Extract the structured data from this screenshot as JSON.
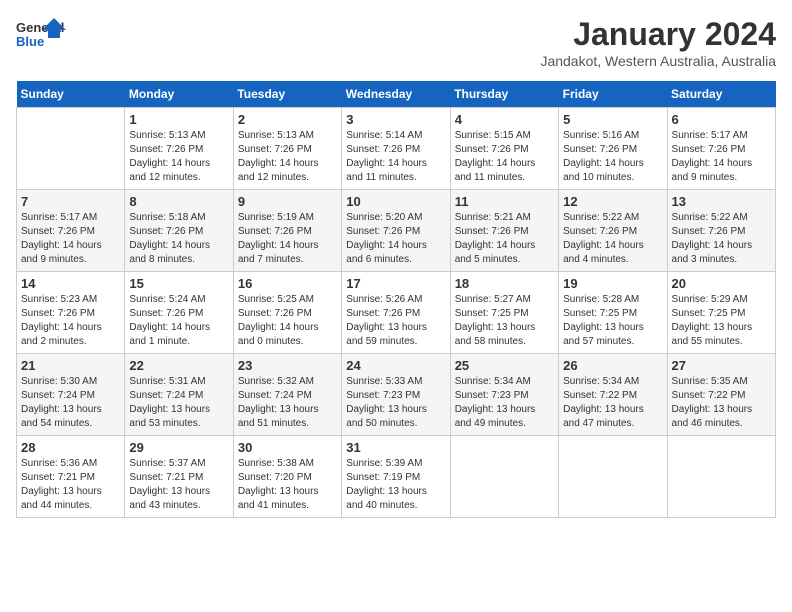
{
  "logo": {
    "line1": "General",
    "line2": "Blue"
  },
  "title": "January 2024",
  "subtitle": "Jandakot, Western Australia, Australia",
  "days_of_week": [
    "Sunday",
    "Monday",
    "Tuesday",
    "Wednesday",
    "Thursday",
    "Friday",
    "Saturday"
  ],
  "weeks": [
    [
      {
        "day": "",
        "info": ""
      },
      {
        "day": "1",
        "info": "Sunrise: 5:13 AM\nSunset: 7:26 PM\nDaylight: 14 hours\nand 12 minutes."
      },
      {
        "day": "2",
        "info": "Sunrise: 5:13 AM\nSunset: 7:26 PM\nDaylight: 14 hours\nand 12 minutes."
      },
      {
        "day": "3",
        "info": "Sunrise: 5:14 AM\nSunset: 7:26 PM\nDaylight: 14 hours\nand 11 minutes."
      },
      {
        "day": "4",
        "info": "Sunrise: 5:15 AM\nSunset: 7:26 PM\nDaylight: 14 hours\nand 11 minutes."
      },
      {
        "day": "5",
        "info": "Sunrise: 5:16 AM\nSunset: 7:26 PM\nDaylight: 14 hours\nand 10 minutes."
      },
      {
        "day": "6",
        "info": "Sunrise: 5:17 AM\nSunset: 7:26 PM\nDaylight: 14 hours\nand 9 minutes."
      }
    ],
    [
      {
        "day": "7",
        "info": "Sunrise: 5:17 AM\nSunset: 7:26 PM\nDaylight: 14 hours\nand 9 minutes."
      },
      {
        "day": "8",
        "info": "Sunrise: 5:18 AM\nSunset: 7:26 PM\nDaylight: 14 hours\nand 8 minutes."
      },
      {
        "day": "9",
        "info": "Sunrise: 5:19 AM\nSunset: 7:26 PM\nDaylight: 14 hours\nand 7 minutes."
      },
      {
        "day": "10",
        "info": "Sunrise: 5:20 AM\nSunset: 7:26 PM\nDaylight: 14 hours\nand 6 minutes."
      },
      {
        "day": "11",
        "info": "Sunrise: 5:21 AM\nSunset: 7:26 PM\nDaylight: 14 hours\nand 5 minutes."
      },
      {
        "day": "12",
        "info": "Sunrise: 5:22 AM\nSunset: 7:26 PM\nDaylight: 14 hours\nand 4 minutes."
      },
      {
        "day": "13",
        "info": "Sunrise: 5:22 AM\nSunset: 7:26 PM\nDaylight: 14 hours\nand 3 minutes."
      }
    ],
    [
      {
        "day": "14",
        "info": "Sunrise: 5:23 AM\nSunset: 7:26 PM\nDaylight: 14 hours\nand 2 minutes."
      },
      {
        "day": "15",
        "info": "Sunrise: 5:24 AM\nSunset: 7:26 PM\nDaylight: 14 hours\nand 1 minute."
      },
      {
        "day": "16",
        "info": "Sunrise: 5:25 AM\nSunset: 7:26 PM\nDaylight: 14 hours\nand 0 minutes."
      },
      {
        "day": "17",
        "info": "Sunrise: 5:26 AM\nSunset: 7:26 PM\nDaylight: 13 hours\nand 59 minutes."
      },
      {
        "day": "18",
        "info": "Sunrise: 5:27 AM\nSunset: 7:25 PM\nDaylight: 13 hours\nand 58 minutes."
      },
      {
        "day": "19",
        "info": "Sunrise: 5:28 AM\nSunset: 7:25 PM\nDaylight: 13 hours\nand 57 minutes."
      },
      {
        "day": "20",
        "info": "Sunrise: 5:29 AM\nSunset: 7:25 PM\nDaylight: 13 hours\nand 55 minutes."
      }
    ],
    [
      {
        "day": "21",
        "info": "Sunrise: 5:30 AM\nSunset: 7:24 PM\nDaylight: 13 hours\nand 54 minutes."
      },
      {
        "day": "22",
        "info": "Sunrise: 5:31 AM\nSunset: 7:24 PM\nDaylight: 13 hours\nand 53 minutes."
      },
      {
        "day": "23",
        "info": "Sunrise: 5:32 AM\nSunset: 7:24 PM\nDaylight: 13 hours\nand 51 minutes."
      },
      {
        "day": "24",
        "info": "Sunrise: 5:33 AM\nSunset: 7:23 PM\nDaylight: 13 hours\nand 50 minutes."
      },
      {
        "day": "25",
        "info": "Sunrise: 5:34 AM\nSunset: 7:23 PM\nDaylight: 13 hours\nand 49 minutes."
      },
      {
        "day": "26",
        "info": "Sunrise: 5:34 AM\nSunset: 7:22 PM\nDaylight: 13 hours\nand 47 minutes."
      },
      {
        "day": "27",
        "info": "Sunrise: 5:35 AM\nSunset: 7:22 PM\nDaylight: 13 hours\nand 46 minutes."
      }
    ],
    [
      {
        "day": "28",
        "info": "Sunrise: 5:36 AM\nSunset: 7:21 PM\nDaylight: 13 hours\nand 44 minutes."
      },
      {
        "day": "29",
        "info": "Sunrise: 5:37 AM\nSunset: 7:21 PM\nDaylight: 13 hours\nand 43 minutes."
      },
      {
        "day": "30",
        "info": "Sunrise: 5:38 AM\nSunset: 7:20 PM\nDaylight: 13 hours\nand 41 minutes."
      },
      {
        "day": "31",
        "info": "Sunrise: 5:39 AM\nSunset: 7:19 PM\nDaylight: 13 hours\nand 40 minutes."
      },
      {
        "day": "",
        "info": ""
      },
      {
        "day": "",
        "info": ""
      },
      {
        "day": "",
        "info": ""
      }
    ]
  ]
}
